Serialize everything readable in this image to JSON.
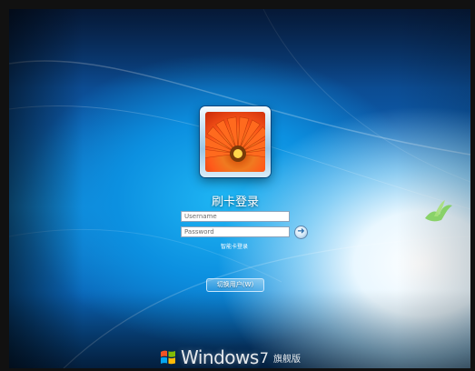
{
  "login": {
    "title": "刷卡登录",
    "username_placeholder": "Username",
    "password_placeholder": "Password",
    "smartcard_link": "智能卡登录",
    "switch_user_label": "切换用户(W)"
  },
  "branding": {
    "logo_icon": "windows-flag-icon",
    "name": "Windows",
    "version": "7",
    "edition": "旗舰版"
  },
  "icons": {
    "avatar": "gerbera-flower-avatar",
    "submit": "arrow-right-icon",
    "decoration": "bird-icon"
  },
  "colors": {
    "background": "#1487d6",
    "avatar_frame": "#9cc7e6",
    "text": "#ffffff"
  }
}
